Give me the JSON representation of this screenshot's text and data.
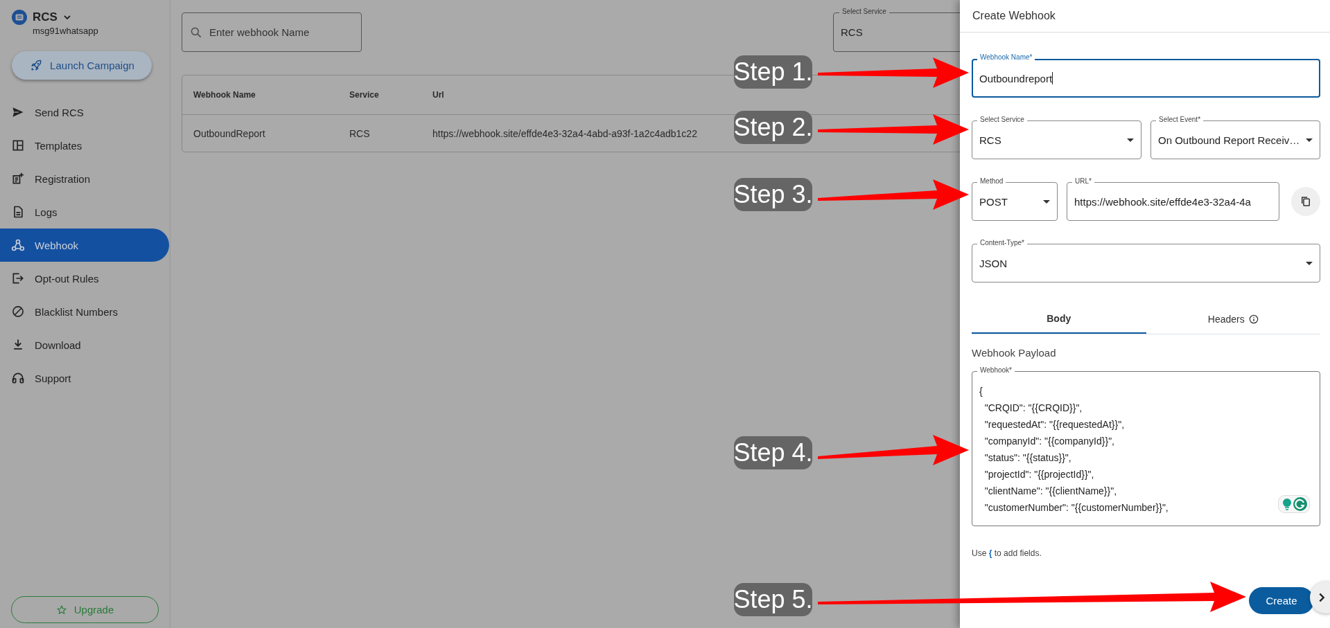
{
  "sidebar": {
    "brand": "RCS",
    "account": "msg91whatsapp",
    "launch_button": "Launch Campaign",
    "items": [
      {
        "label": "Send RCS",
        "selected": false
      },
      {
        "label": "Templates",
        "selected": false
      },
      {
        "label": "Registration",
        "selected": false
      },
      {
        "label": "Logs",
        "selected": false
      },
      {
        "label": "Webhook",
        "selected": true
      },
      {
        "label": "Opt-out Rules",
        "selected": false
      },
      {
        "label": "Blacklist Numbers",
        "selected": false
      },
      {
        "label": "Download",
        "selected": false
      },
      {
        "label": "Support",
        "selected": false
      }
    ],
    "upgrade_button": "Upgrade"
  },
  "toolbar": {
    "search": {
      "placeholder": "Enter webhook Name"
    },
    "service_select": {
      "label": "Select Service",
      "value": "RCS"
    }
  },
  "table": {
    "columns": [
      "Webhook Name",
      "Service",
      "Url"
    ],
    "rows": [
      [
        "OutboundReport",
        "RCS",
        "https://webhook.site/effde4e3-32a4-4abd-a93f-1a2c4adb1c22"
      ]
    ]
  },
  "drawer": {
    "title": "Create Webhook",
    "form_rows": [
      [
        {
          "kind": "text",
          "label": "Webhook Name*",
          "value": "Outboundreport",
          "focused": true
        }
      ],
      [
        {
          "kind": "select",
          "label": "Select Service",
          "value": "RCS",
          "focused": false
        },
        {
          "kind": "select",
          "label": "Select Event*",
          "value": "On Outbound Report Receiv…",
          "focused": false
        }
      ],
      [
        {
          "kind": "select",
          "label": "Method",
          "value": "POST",
          "focused": false
        },
        {
          "kind": "text",
          "label": "URL*",
          "value": "https://webhook.site/effde4e3-32a4-4a",
          "focused": false
        },
        {
          "kind": "copy"
        }
      ],
      [
        {
          "kind": "select",
          "label": "Content-Type*",
          "value": "JSON",
          "focused": false
        }
      ]
    ],
    "tabs": [
      {
        "label": "Body",
        "selected": true
      },
      {
        "label": "Headers",
        "selected": false
      }
    ],
    "payload_title": "Webhook Payload",
    "payload": {
      "label": "Webhook*",
      "lines": [
        "{",
        "  \"CRQID\": \"{{CRQID}}\",",
        "  \"requestedAt\": \"{{requestedAt}}\",",
        "  \"companyId\": \"{{companyId}}\",",
        "  \"status\": \"{{status}}\",",
        "  \"projectId\": \"{{projectId}}\",",
        "  \"clientName\": \"{{clientName}}\",",
        "  \"customerNumber\": \"{{customerNumber}}\","
      ]
    },
    "hint": "Use **{** to add fields.",
    "create_button": "Create"
  },
  "annotations": [
    {
      "label": "Step 1."
    },
    {
      "label": "Step 2."
    },
    {
      "label": "Step 3."
    },
    {
      "label": "Step 4."
    },
    {
      "label": "Step 5."
    }
  ]
}
